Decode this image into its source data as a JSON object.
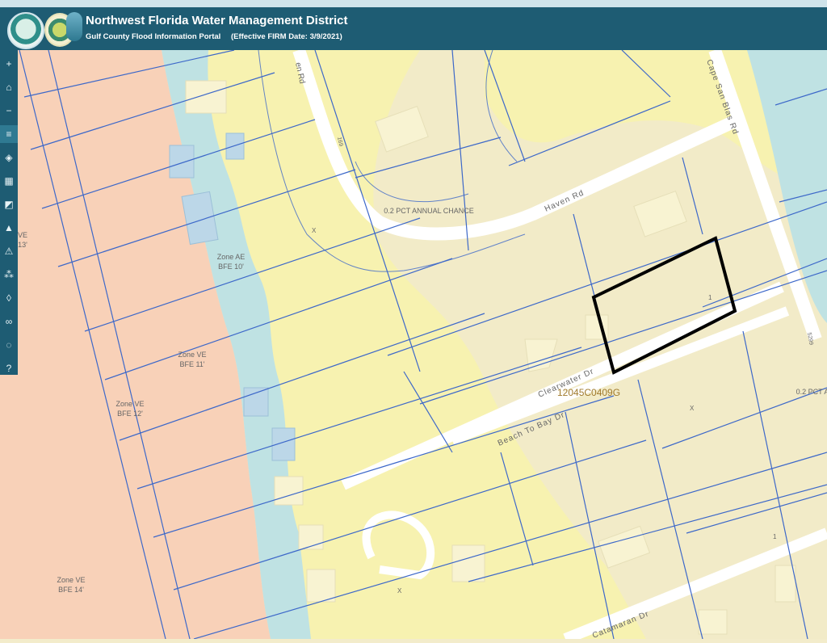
{
  "header": {
    "title": "Northwest Florida Water Management District",
    "subtitle": "Gulf County Flood Information Portal",
    "effective_date": "(Effective FIRM Date: 3/9/2021)"
  },
  "toolbar": {
    "items": [
      {
        "icon": "plus-icon",
        "glyph": "+"
      },
      {
        "icon": "home-icon",
        "glyph": "⌂"
      },
      {
        "icon": "minus-icon",
        "glyph": "−"
      },
      {
        "icon": "menu-icon",
        "glyph": "≡"
      },
      {
        "icon": "layers-icon",
        "glyph": "◈"
      },
      {
        "icon": "basemap-icon",
        "glyph": "▦"
      },
      {
        "icon": "chart-icon",
        "glyph": "◩"
      },
      {
        "icon": "north-arrow-icon",
        "glyph": "▲"
      },
      {
        "icon": "warning-icon",
        "glyph": "⚠"
      },
      {
        "icon": "network-icon",
        "glyph": "⁂"
      },
      {
        "icon": "drop-icon",
        "glyph": "◊"
      },
      {
        "icon": "link-icon",
        "glyph": "∞"
      },
      {
        "icon": "speech-icon",
        "glyph": "◌"
      },
      {
        "icon": "help-icon",
        "glyph": "?"
      }
    ]
  },
  "map": {
    "colors": {
      "zone_ve": "#f8d1b8",
      "zone_ae": "#bfe2e3",
      "zone_x": "#f2ebc8",
      "zone_02pct": "#f7f2b0",
      "parcel_line": "#3d68c9",
      "road": "#ffffff",
      "highlight": "#000000"
    },
    "roads": {
      "haven_rd": "Haven Rd",
      "haven_rd_partial": "en Rd",
      "cape_san_blas_rd": "Cape San Blas Rd",
      "clearwater_dr": "Clearwater Dr",
      "beach_to_bay_dr": "Beach To Bay Dr",
      "catamaran_dr": "Catamaran Dr"
    },
    "zones": {
      "ve13_zone": "VE",
      "ve13_bfe": "13'",
      "ae_zone": "Zone AE",
      "ae_bfe": "BFE 10'",
      "ve11_zone": "Zone VE",
      "ve11_bfe": "BFE 11'",
      "ve12_zone": "Zone VE",
      "ve12_bfe": "BFE 12'",
      "ve14_zone": "Zone VE",
      "ve14_bfe": "BFE 14'",
      "pct_annual_chance": "0.2 PCT ANNUAL CHANCE",
      "pct_right_edge": "0.2 PCT A"
    },
    "panel": "12045C0409G",
    "markers": {
      "x1": "X",
      "x2": "X",
      "x3": "X",
      "one_a": "1",
      "one_b": "1",
      "num_169": "169",
      "num_5299": "5299"
    }
  }
}
